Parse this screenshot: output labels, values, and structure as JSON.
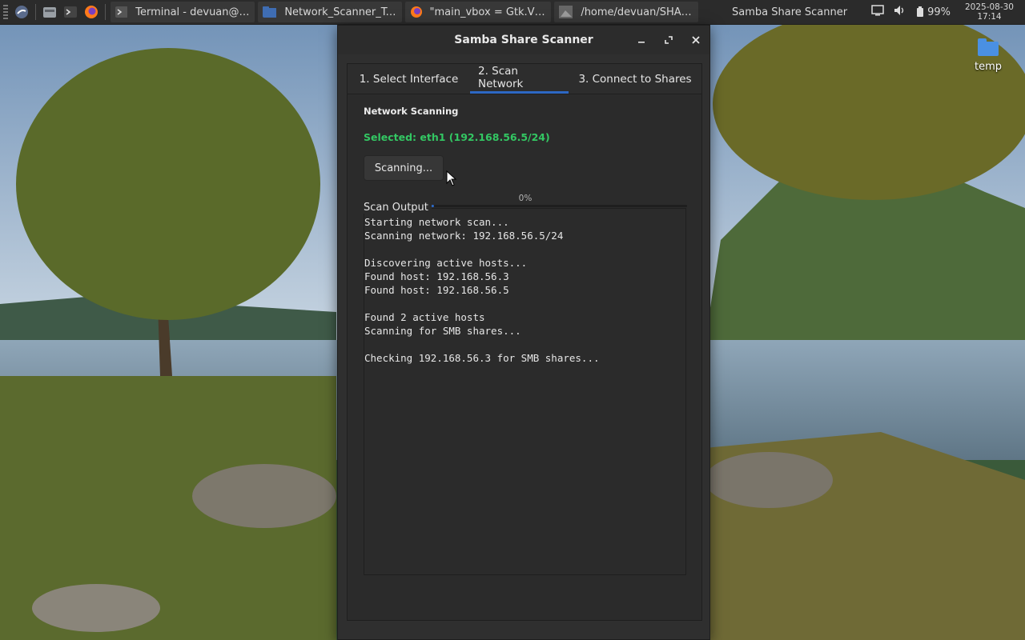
{
  "taskbar": {
    "tasks": [
      {
        "label": "Terminal - devuan@d...",
        "icon": "terminal-icon"
      },
      {
        "label": "Network_Scanner_To...",
        "icon": "folder-icon"
      },
      {
        "label": "\"main_vbox = Gtk.VBo...",
        "icon": "firefox-icon"
      },
      {
        "label": "/home/devuan/SHAR...",
        "icon": "image-viewer-icon"
      }
    ],
    "active_window_title": "Samba Share Scanner",
    "battery": "99%",
    "clock_date": "2025-08-30",
    "clock_time": "17:14"
  },
  "desktop": {
    "icons": [
      {
        "label": "temp",
        "icon": "folder-icon"
      }
    ]
  },
  "window": {
    "title": "Samba Share Scanner",
    "tabs": [
      {
        "label": "1. Select Interface",
        "active": false
      },
      {
        "label": "2. Scan Network",
        "active": true
      },
      {
        "label": "3. Connect to Shares",
        "active": false
      }
    ],
    "section_title": "Network Scanning",
    "selected_interface": "Selected: eth1 (192.168.56.5/24)",
    "scan_button_label": "Scanning...",
    "progress_text": "0%",
    "progress_fraction": 0.0,
    "output_label": "Scan Output",
    "output_text": "Starting network scan...\nScanning network: 192.168.56.5/24\n\nDiscovering active hosts...\nFound host: 192.168.56.3\nFound host: 192.168.56.5\n\nFound 2 active hosts\nScanning for SMB shares...\n\nChecking 192.168.56.3 for SMB shares..."
  },
  "colors": {
    "accent": "#2d68c4",
    "success_text": "#33c763",
    "window_bg": "#2f2f2f",
    "taskbar_bg": "#2b2b2b"
  }
}
